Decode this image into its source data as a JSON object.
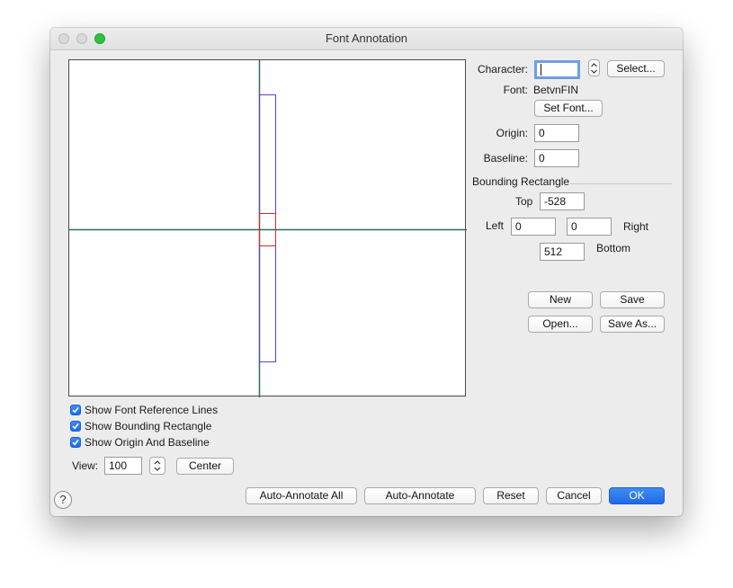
{
  "window": {
    "title": "Font Annotation"
  },
  "colors": {
    "reference_lines": "#2f6b5f",
    "bounding_rect": "#5a3fd6",
    "origin_baseline": "#e0202a",
    "accent": "#1f6ae3"
  },
  "character": {
    "label": "Character:",
    "value": "",
    "select_button": "Select..."
  },
  "font": {
    "label": "Font:",
    "name": "BetvnFIN",
    "set_button": "Set Font..."
  },
  "origin": {
    "label": "Origin:",
    "value": "0"
  },
  "baseline": {
    "label": "Baseline:",
    "value": "0"
  },
  "bounding": {
    "heading": "Bounding Rectangle",
    "top_label": "Top",
    "top": "-528",
    "left_label": "Left",
    "left": "0",
    "right_label": "Right",
    "right": "0",
    "bottom_label": "Bottom",
    "bottom": "512"
  },
  "file_buttons": {
    "new": "New",
    "save": "Save",
    "open": "Open...",
    "save_as": "Save As..."
  },
  "options": {
    "show_font_reference_lines": {
      "label": "Show Font Reference Lines",
      "checked": true
    },
    "show_bounding_rectangle": {
      "label": "Show Bounding Rectangle",
      "checked": true
    },
    "show_origin_and_baseline": {
      "label": "Show Origin And Baseline",
      "checked": true
    }
  },
  "view": {
    "label": "View:",
    "value": "100",
    "center_button": "Center"
  },
  "footer": {
    "help": "?",
    "auto_annotate_all": "Auto-Annotate All",
    "auto_annotate": "Auto-Annotate",
    "reset": "Reset",
    "cancel": "Cancel",
    "ok": "OK"
  }
}
